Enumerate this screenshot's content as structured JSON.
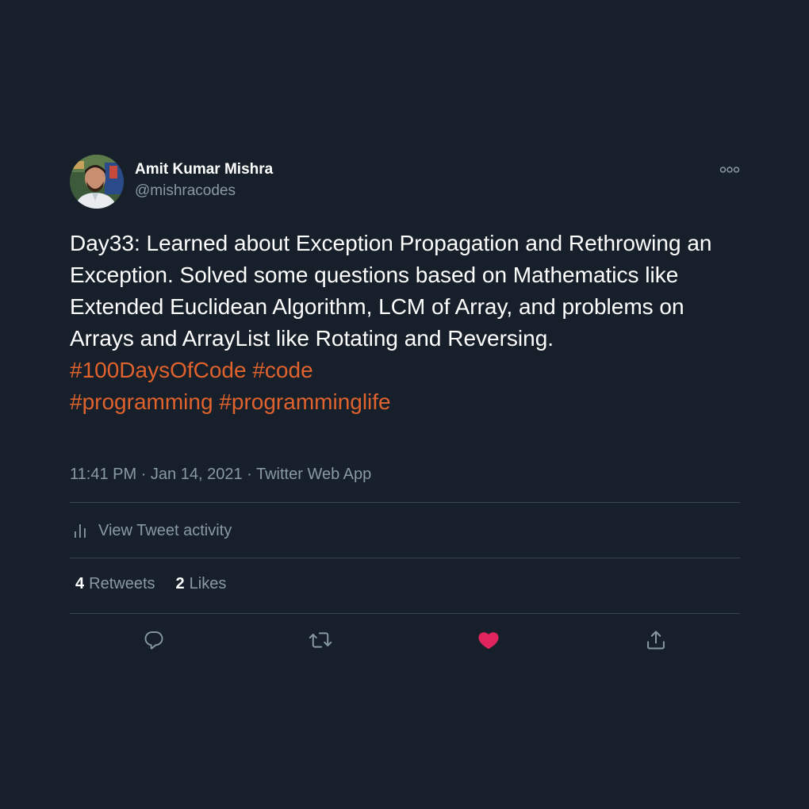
{
  "tweet": {
    "author": {
      "name": "Amit Kumar Mishra",
      "handle": "@mishracodes"
    },
    "text": "Day33: Learned about Exception Propagation and Rethrowing an Exception. Solved some questions based on Mathematics like Extended Euclidean Algorithm, LCM of Array, and problems on Arrays and ArrayList like Rotating and Reversing.",
    "hashtags_line1": [
      "#100DaysOfCode",
      "#code"
    ],
    "hashtags_line2": [
      "#programming",
      "#programminglife"
    ],
    "time": "11:41 PM",
    "date": "Jan 14, 2021",
    "source": "Twitter Web App",
    "separator": "·",
    "activity_label": "View Tweet activity",
    "retweets_count": "4",
    "retweets_label": "Retweets",
    "likes_count": "2",
    "likes_label": "Likes"
  },
  "icons": {
    "more": "more-options-icon",
    "activity": "bar-chart-icon",
    "reply": "reply-icon",
    "retweet": "retweet-icon",
    "like": "heart-icon",
    "share": "share-icon"
  },
  "colors": {
    "background": "#17202a",
    "text": "#ffffff",
    "secondary": "#8899a6",
    "hashtag": "#e0622d",
    "like": "#e0245e",
    "divider": "#38444d"
  }
}
